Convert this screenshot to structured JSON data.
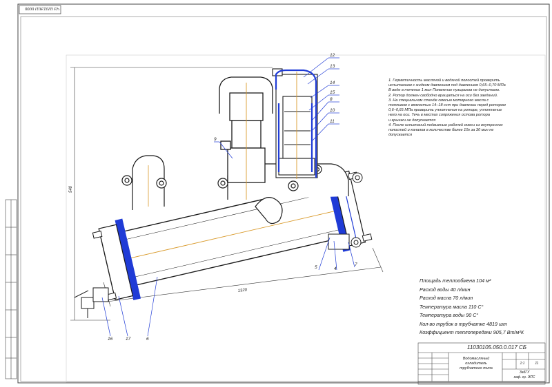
{
  "corner_label": "ЧЗ 0201Э01Г0000",
  "dimension_labels": {
    "height": "540",
    "length": "1320"
  },
  "callouts": [
    "12",
    "13",
    "14",
    "15",
    "8",
    "10",
    "11",
    "9",
    "5",
    "4",
    "7",
    "16",
    "17",
    "6"
  ],
  "notes": [
    "1. Герметичность масляной и водяной полостей проверить",
    "   испытанием с жидким давлением под давлением 0,65–0,70 МПа",
    "   В воде в течение 1 мин Появление пузырьков не допустимо.",
    "2. Ротор должен свободно вращаться на оси без заеданий.",
    "3. На специальном стенде смесью моторного масла с",
    "   топливом с вязкостью 14–18 сст при давлении перед ротором",
    "   0,6–0,65 МПа проверить уплотнения на роторе, уплотнение",
    "   него на оси. Течь в местах сопряжения остова ротора",
    "   и крышки не допускается",
    "4. После испытаний подвижные рабочей смеси из внутренних",
    "   полостей и каналов в количестве более 10г за 30 мин не",
    "   допускается"
  ],
  "specs": [
    "Площадь теплообмена 104 м²",
    "Расход воды 40 л/мин",
    "Расход масла 70 л/мин",
    "Температура масла 110 С°",
    "Температура воды 90 С°",
    "Кол-во трубок в трубчатке 4819 шт",
    "Коэффициент теплопередачи 905,7 Вт/м²К"
  ],
  "title_block": {
    "designation": "11030105.050.0.017 СБ",
    "name_line1": "Водомасляный",
    "name_line2": "охладитель",
    "name_line3": "трубчатого типа",
    "scale": "1:1",
    "sheet": "11",
    "org_line1": "ЗабГУ",
    "org_line2": "каф. гр. ЭПС"
  },
  "colors": {
    "line": "#1a1a1a",
    "blue": "#1f3bd6",
    "orange": "#d99a2b",
    "frame": "#444444"
  }
}
